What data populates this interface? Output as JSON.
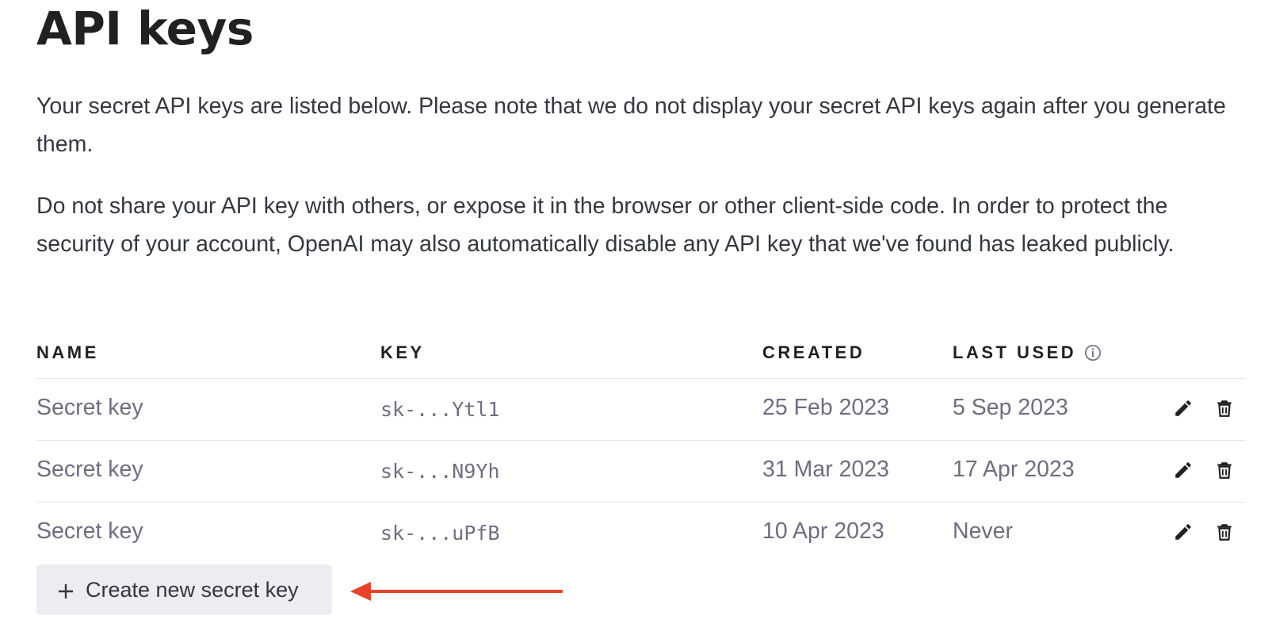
{
  "page": {
    "title": "API keys",
    "intro": "Your secret API keys are listed below. Please note that we do not display your secret API keys again after you generate them.",
    "warning": "Do not share your API key with others, or expose it in the browser or other client-side code. In order to protect the security of your account, OpenAI may also automatically disable any API key that we've found has leaked publicly."
  },
  "table": {
    "headers": {
      "name": "NAME",
      "key": "KEY",
      "created": "CREATED",
      "last_used": "LAST USED"
    },
    "rows": [
      {
        "name": "Secret key",
        "key": "sk-...Ytl1",
        "created": "25 Feb 2023",
        "last_used": "5 Sep 2023"
      },
      {
        "name": "Secret key",
        "key": "sk-...N9Yh",
        "created": "31 Mar 2023",
        "last_used": "17 Apr 2023"
      },
      {
        "name": "Secret key",
        "key": "sk-...uPfB",
        "created": "10 Apr 2023",
        "last_used": "Never"
      }
    ]
  },
  "actions": {
    "create_label": "Create new secret key"
  },
  "icons": {
    "info": "info-icon",
    "edit": "pencil-icon",
    "delete": "trash-icon",
    "plus": "plus-icon"
  },
  "colors": {
    "annotation_arrow": "#e8432b",
    "button_bg": "#ececf1"
  }
}
